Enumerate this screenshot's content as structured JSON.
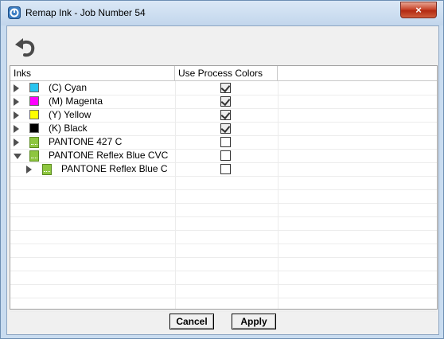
{
  "window": {
    "title": "Remap Ink - Job Number 54",
    "close_glyph": "×"
  },
  "toolbar": {
    "undo_icon": "undo-arrow-icon"
  },
  "table": {
    "columns": [
      "Inks",
      "Use Process Colors"
    ],
    "rows": [
      {
        "label": "(C) Cyan",
        "swatch": "#27c4f0",
        "kind": "process",
        "expanded": false,
        "indent": 0,
        "checked": true
      },
      {
        "label": "(M) Magenta",
        "swatch": "#ff00ff",
        "kind": "process",
        "expanded": false,
        "indent": 0,
        "checked": true
      },
      {
        "label": "(Y) Yellow",
        "swatch": "#ffff00",
        "kind": "process",
        "expanded": false,
        "indent": 0,
        "checked": true
      },
      {
        "label": "(K) Black",
        "swatch": "#000000",
        "kind": "process",
        "expanded": false,
        "indent": 0,
        "checked": true
      },
      {
        "label": "PANTONE 427 C",
        "swatch": "#8ec63f",
        "kind": "spot",
        "expanded": false,
        "indent": 0,
        "checked": false
      },
      {
        "label": "PANTONE Reflex Blue CVC",
        "swatch": "#8ec63f",
        "kind": "spot",
        "expanded": true,
        "indent": 0,
        "checked": false
      },
      {
        "label": "PANTONE Reflex Blue C",
        "swatch": "#8ec63f",
        "kind": "spot",
        "expanded": false,
        "indent": 1,
        "checked": false
      }
    ]
  },
  "buttons": {
    "cancel": "Cancel",
    "apply": "Apply"
  }
}
